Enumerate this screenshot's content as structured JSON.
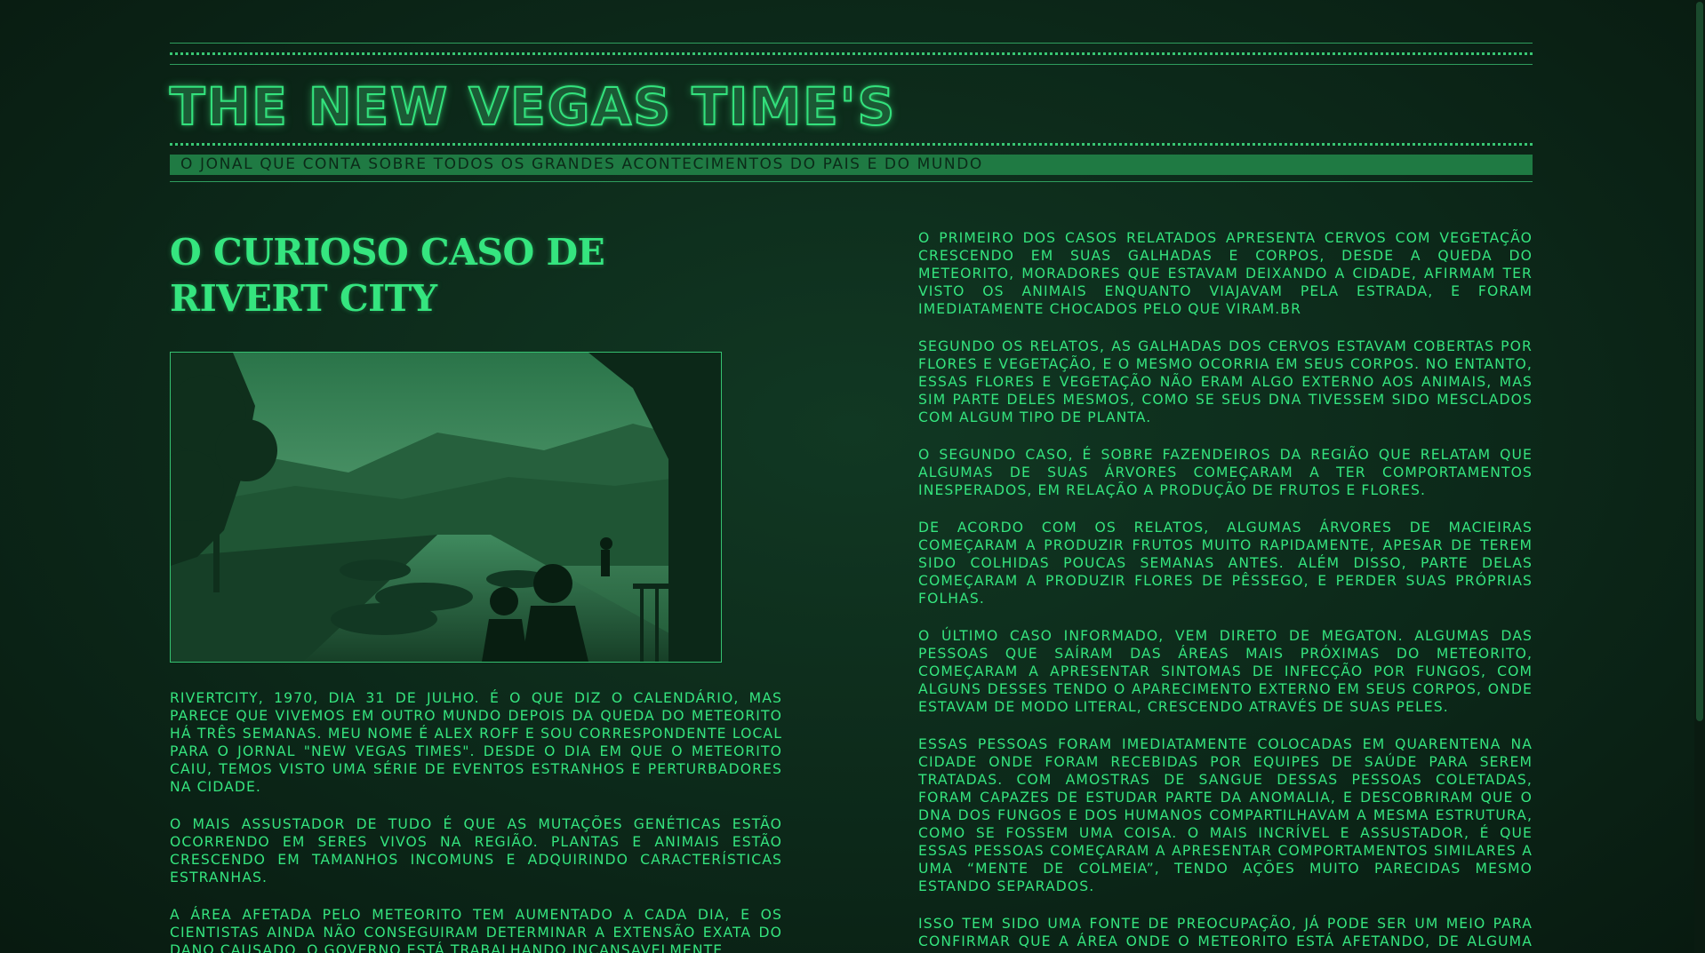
{
  "masthead": {
    "title": "THE NEW VEGAS TIME'S",
    "subtitle": "O JONAL QUE CONTA SOBRE TODOS OS GRANDES ACONTECIMENTOS DO PAIS E DO MUNDO"
  },
  "article": {
    "headline": "O CURIOSO CASO DE RIVERT CITY",
    "left_paragraphs": [
      "RIVERTCITY, 1970, DIA 31 DE JULHO. É O QUE DIZ O CALENDÁRIO, MAS PARECE QUE VIVEMOS EM OUTRO MUNDO DEPOIS DA QUEDA DO METEORITO HÁ TRÊS SEMANAS. MEU NOME É ALEX ROFF E SOU CORRESPONDENTE LOCAL PARA O JORNAL \"NEW VEGAS TIMES\". DESDE O DIA EM QUE O METEORITO CAIU, TEMOS VISTO UMA SÉRIE DE EVENTOS ESTRANHOS E PERTURBADORES NA CIDADE.",
      "O MAIS ASSUSTADOR DE TUDO É QUE AS MUTAÇÕES GENÉTICAS ESTÃO OCORRENDO EM SERES VIVOS NA REGIÃO. PLANTAS E ANIMAIS ESTÃO CRESCENDO EM TAMANHOS INCOMUNS E ADQUIRINDO CARACTERÍSTICAS ESTRANHAS.",
      "A ÁREA AFETADA PELO METEORITO TEM AUMENTADO A CADA DIA, E OS CIENTISTAS AINDA NÃO CONSEGUIRAM DETERMINAR A EXTENSÃO EXATA DO DANO CAUSADO. O GOVERNO ESTÁ TRABALHANDO INCANSAVELMENTE"
    ],
    "right_paragraphs": [
      "O PRIMEIRO DOS CASOS RELATADOS APRESENTA CERVOS COM VEGETAÇÃO CRESCENDO EM SUAS GALHADAS E CORPOS, DESDE A QUEDA DO METEORITO, MORADORES QUE ESTAVAM DEIXANDO A CIDADE, AFIRMAM TER VISTO OS ANIMAIS ENQUANTO VIAJAVAM PELA ESTRADA, E FORAM IMEDIATAMENTE CHOCADOS PELO QUE VIRAM.BR",
      "SEGUNDO OS RELATOS, AS GALHADAS DOS CERVOS ESTAVAM COBERTAS POR FLORES E VEGETAÇÃO, E O MESMO OCORRIA EM SEUS CORPOS. NO ENTANTO, ESSAS FLORES E VEGETAÇÃO NÃO ERAM ALGO EXTERNO AOS ANIMAIS, MAS SIM PARTE DELES MESMOS, COMO SE SEUS DNA TIVESSEM SIDO MESCLADOS COM ALGUM TIPO DE PLANTA.",
      "O SEGUNDO CASO, É SOBRE FAZENDEIROS DA REGIÃO QUE RELATAM QUE ALGUMAS DE SUAS ÁRVORES COMEÇARAM A TER COMPORTAMENTOS INESPERADOS, EM RELAÇÃO A PRODUÇÃO DE FRUTOS E FLORES.",
      "DE ACORDO COM OS RELATOS, ALGUMAS ÁRVORES DE MACIEIRAS COMEÇARAM A PRODUZIR FRUTOS MUITO RAPIDAMENTE, APESAR DE TEREM SIDO COLHIDAS POUCAS SEMANAS ANTES. ALÉM DISSO, PARTE DELAS COMEÇARAM A PRODUZIR FLORES DE PÊSSEGO, E PERDER SUAS PRÓPRIAS FOLHAS.",
      "O ÚLTIMO CASO INFORMADO, VEM DIRETO DE MEGATON. ALGUMAS DAS PESSOAS QUE SAÍRAM DAS ÁREAS MAIS PRÓXIMAS DO METEORITO, COMEÇARAM A APRESENTAR SINTOMAS DE INFECÇÃO POR FUNGOS, COM ALGUNS DESSES TENDO O APARECIMENTO EXTERNO EM SEUS CORPOS, ONDE ESTAVAM DE MODO LITERAL, CRESCENDO ATRAVÉS DE SUAS PELES.",
      "ESSAS PESSOAS FORAM IMEDIATAMENTE COLOCADAS EM QUARENTENA NA CIDADE ONDE FORAM RECEBIDAS POR EQUIPES DE SAÚDE PARA SEREM TRATADAS. COM AMOSTRAS DE SANGUE DESSAS PESSOAS COLETADAS, FORAM CAPAZES DE ESTUDAR PARTE DA ANOMALIA, E DESCOBRIRAM QUE O DNA DOS FUNGOS E DOS HUMANOS COMPARTILHAVAM A MESMA ESTRUTURA, COMO SE FOSSEM UMA COISA. O MAIS INCRÍVEL E ASSUSTADOR, É QUE ESSAS PESSOAS COMEÇARAM A APRESENTAR COMPORTAMENTOS SIMILARES A UMA “MENTE DE COLMEIA”, TENDO AÇÕES MUITO PARECIDAS MESMO ESTANDO SEPARADOS.",
      "ISSO TEM SIDO UMA FONTE DE PREOCUPAÇÃO, JÁ PODE SER UM MEIO PARA CONFIRMAR QUE A ÁREA ONDE O METEORITO ESTÁ AFETANDO, DE ALGUMA FORMA, CAUSA A ANOMALIA GENETICA NOS SERES VIVOS LOCAIS,"
    ]
  },
  "colors": {
    "background": "#0c2819",
    "text": "#35e57f",
    "subtitle_bar": "#1f7a43"
  }
}
